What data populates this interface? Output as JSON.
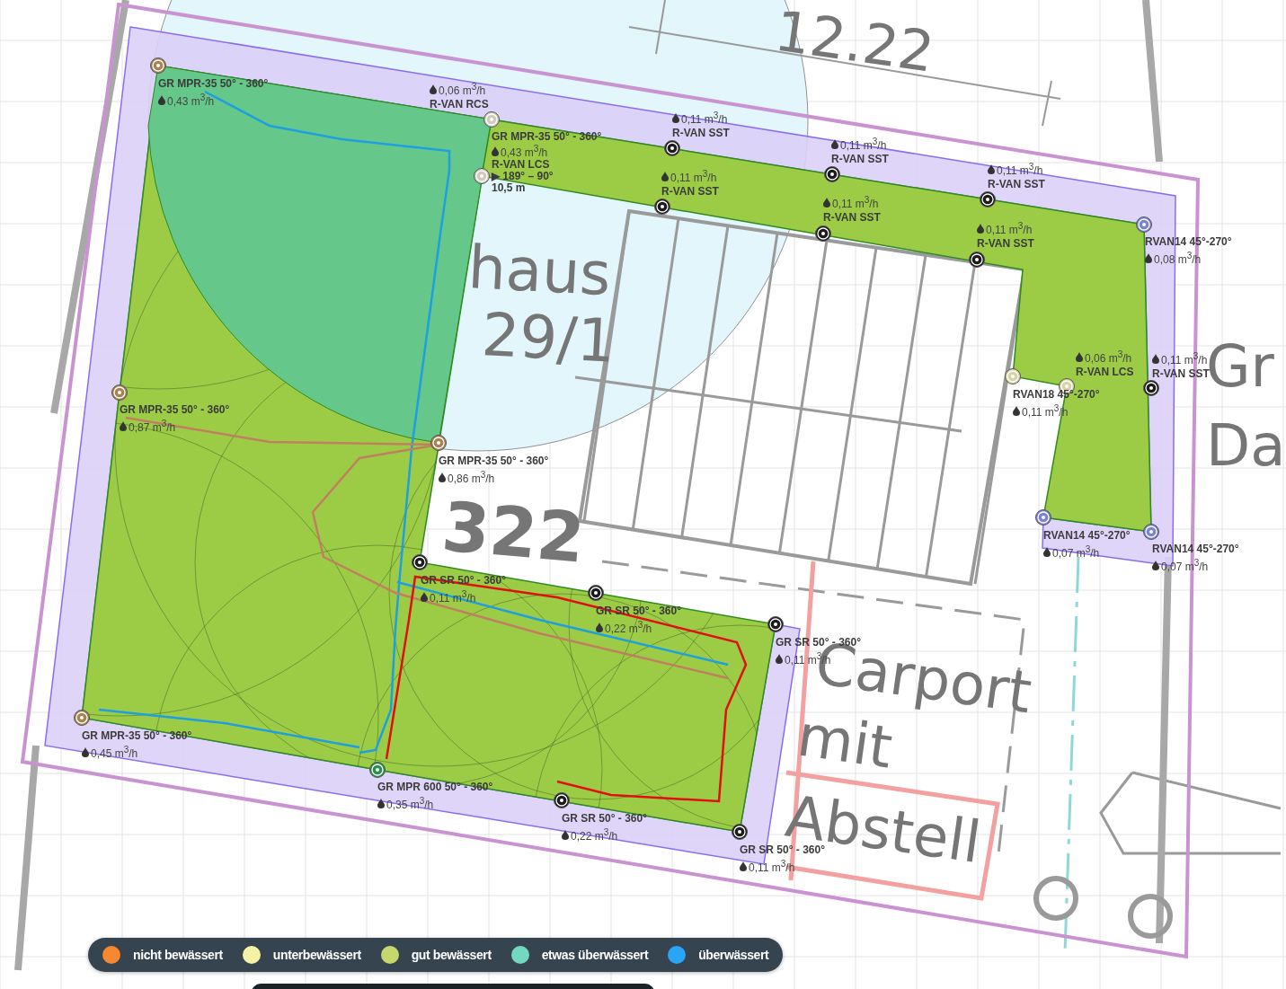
{
  "plan_labels": [
    {
      "text": "12.22"
    },
    {
      "text": "haus"
    },
    {
      "text": "29/1"
    },
    {
      "text": "322"
    },
    {
      "text": "Carport"
    },
    {
      "text": "mit"
    },
    {
      "text": "Abstell"
    },
    {
      "text": "Gr"
    },
    {
      "text": "Da"
    }
  ],
  "sprinklers": [
    {
      "kind": "mpr",
      "lines": [
        {
          "kind": "model",
          "text": "GR MPR-35 50° - 360°"
        },
        {
          "kind": "flow",
          "text": "0,43 m$^{3}$/h"
        }
      ]
    },
    {
      "kind": "rcs",
      "lines": [
        {
          "kind": "flow",
          "text": "0,06 m$^{3}$/h"
        },
        {
          "kind": "model",
          "text": "R-VAN RCS"
        }
      ]
    },
    {
      "kind": "rvan",
      "lines": [
        {
          "kind": "flow",
          "text": "0,11 m$^{3}$/h"
        },
        {
          "kind": "model",
          "text": "R-VAN SST"
        }
      ]
    },
    {
      "kind": "rvan",
      "lines": [
        {
          "kind": "flow",
          "text": "0,11 m$^{3}$/h"
        },
        {
          "kind": "model",
          "text": "R-VAN SST"
        }
      ]
    },
    {
      "kind": "rvan",
      "lines": [
        {
          "kind": "flow",
          "text": "0,11 m$^{3}$/h"
        },
        {
          "kind": "model",
          "text": "R-VAN SST"
        }
      ]
    },
    {
      "kind": "rvan",
      "lines": [
        {
          "kind": "flow",
          "text": "0,11 m$^{3}$/h"
        },
        {
          "kind": "model",
          "text": "R-VAN SST"
        }
      ]
    },
    {
      "kind": "rvan",
      "lines": [
        {
          "kind": "flow",
          "text": "0,11 m$^{3}$/h"
        },
        {
          "kind": "model",
          "text": "R-VAN SST"
        }
      ]
    },
    {
      "kind": "rvan",
      "lines": [
        {
          "kind": "flow",
          "text": "0,11 m$^{3}$/h"
        },
        {
          "kind": "model",
          "text": "R-VAN SST"
        }
      ]
    },
    {
      "kind": "rvan14",
      "lines": [
        {
          "kind": "model",
          "text": "RVAN14 45°-270°"
        },
        {
          "kind": "flow",
          "text": "0,08 m$^{3}$/h"
        }
      ]
    },
    {
      "kind": "rvan18",
      "lines": [
        {
          "kind": "flow",
          "text": "0,06 m$^{3}$/h"
        },
        {
          "kind": "model",
          "text": "R-VAN LCS"
        }
      ]
    },
    {
      "kind": "rvan",
      "lines": [
        {
          "kind": "flow",
          "text": "0,11 m$^{3}$/h"
        },
        {
          "kind": "model",
          "text": "R-VAN SST"
        }
      ]
    },
    {
      "kind": "rvan18",
      "lines": [
        {
          "kind": "model",
          "text": "RVAN18 45°-270°"
        },
        {
          "kind": "flow",
          "text": "0,11 m$^{3}$/h"
        }
      ]
    },
    {
      "kind": "mpr",
      "lines": [
        {
          "kind": "model",
          "text": "GR MPR-35 50° - 360°"
        },
        {
          "kind": "flow",
          "text": "0,87 m$^{3}$/h"
        }
      ]
    },
    {
      "kind": "mpr",
      "lines": [
        {
          "kind": "model",
          "text": "GR MPR-35 50° - 360°"
        },
        {
          "kind": "flow",
          "text": "0,86 m$^{3}$/h"
        }
      ]
    },
    {
      "kind": "rvan14",
      "lines": [
        {
          "kind": "model",
          "text": "RVAN14 45°-270°"
        },
        {
          "kind": "flow",
          "text": "0,07 m$^{3}$/h"
        }
      ]
    },
    {
      "kind": "rvan14",
      "lines": [
        {
          "kind": "model",
          "text": "RVAN14 45°-270°"
        },
        {
          "kind": "flow",
          "text": "0,07 m$^{3}$/h"
        }
      ]
    },
    {
      "kind": "rvan",
      "lines": [
        {
          "kind": "model",
          "text": "GR SR 50° - 360°"
        },
        {
          "kind": "flow",
          "text": "0,11 m$^{3}$/h"
        }
      ]
    },
    {
      "kind": "rvan",
      "lines": [
        {
          "kind": "model",
          "text": "GR SR 50° - 360°"
        },
        {
          "kind": "flow",
          "text": "0,22 m$^{3}$/h"
        }
      ]
    },
    {
      "kind": "rvan",
      "lines": [
        {
          "kind": "model",
          "text": "GR SR 50° - 360°"
        },
        {
          "kind": "flow",
          "text": "0,11 m$^{3}$/h"
        }
      ]
    },
    {
      "kind": "mpr",
      "lines": [
        {
          "kind": "model",
          "text": "GR MPR-35 50° - 360°"
        },
        {
          "kind": "flow",
          "text": "0,45 m$^{3}$/h"
        }
      ]
    },
    {
      "kind": "mpr600",
      "lines": [
        {
          "kind": "model",
          "text": "GR MPR 600 50° - 360°"
        },
        {
          "kind": "flow",
          "text": "0,35 m$^{3}$/h"
        }
      ]
    },
    {
      "kind": "rvan",
      "lines": [
        {
          "kind": "model",
          "text": "GR SR 50° - 360°"
        },
        {
          "kind": "flow",
          "text": "0,22 m$^{3}$/h"
        }
      ]
    },
    {
      "kind": "rvan",
      "lines": [
        {
          "kind": "model",
          "text": "GR SR 50° - 360°"
        },
        {
          "kind": "flow",
          "text": "0,11 m$^{3}$/h"
        }
      ]
    }
  ],
  "selected_sprinkler": {
    "kind": "rcs",
    "lines": [
      {
        "kind": "model",
        "text": "GR MPR-35 50° - 360°"
      },
      {
        "kind": "flow",
        "text": "0,43 m$^{3}$/h"
      },
      {
        "kind": "model",
        "text": "R-VAN LCS"
      },
      {
        "kind": "text",
        "text": "▶ 189° – 90°"
      },
      {
        "kind": "text",
        "text": "10,5 m"
      }
    ]
  },
  "legend": [
    {
      "label": "nicht bewässert",
      "color": "#f7882f"
    },
    {
      "label": "unterbewässert",
      "color": "#f5f2a8"
    },
    {
      "label": "gut bewässert",
      "color": "#c4d86e"
    },
    {
      "label": "etwas überwässert",
      "color": "#72d8c0"
    },
    {
      "label": "überwässert",
      "color": "#2aa4f4"
    }
  ]
}
